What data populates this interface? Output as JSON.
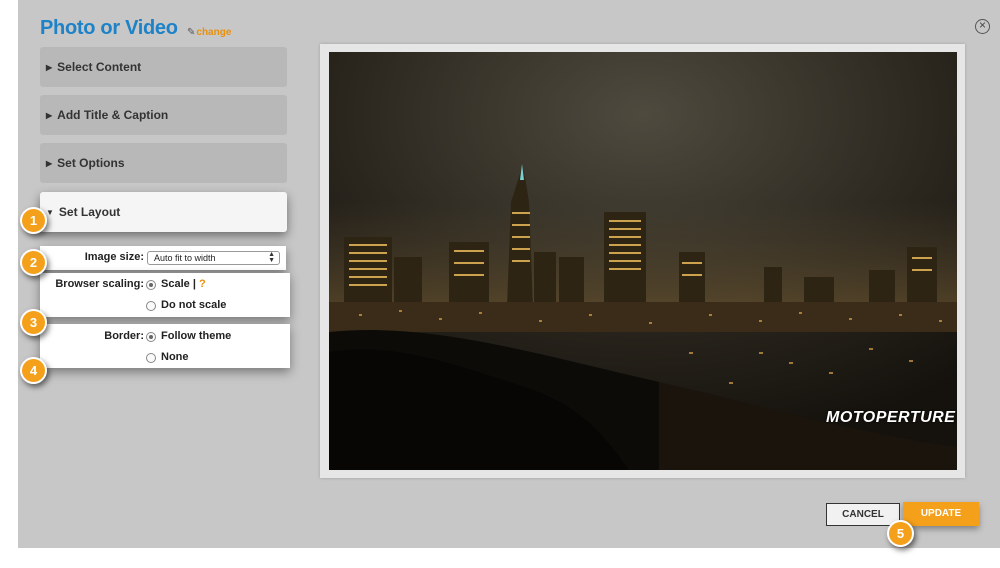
{
  "header": {
    "title": "Photo or Video",
    "change_label": "change"
  },
  "sections": [
    {
      "label": "Select Content",
      "expanded": false
    },
    {
      "label": "Add Title & Caption",
      "expanded": false
    },
    {
      "label": "Set Options",
      "expanded": false
    },
    {
      "label": "Set Layout",
      "expanded": true
    }
  ],
  "layout": {
    "image_size_label": "Image size:",
    "image_size_value": "Auto fit to width",
    "browser_scaling_label": "Browser scaling:",
    "scale_option": "Scale",
    "scale_separator": "|",
    "scale_help": "?",
    "no_scale_option": "Do not scale",
    "border_label": "Border:",
    "follow_theme_option": "Follow theme",
    "none_option": "None",
    "browser_scaling_selected": "Scale",
    "border_selected": "Follow theme"
  },
  "preview": {
    "watermark": "MOTOPERTURE"
  },
  "footer": {
    "cancel_label": "CANCEL",
    "update_label": "UPDATE"
  },
  "callouts": [
    "1",
    "2",
    "3",
    "4",
    "5"
  ],
  "colors": {
    "accent_blue": "#1e82c8",
    "accent_orange": "#f5a01a",
    "panel_bg": "#c7c7c7"
  },
  "icons": {
    "close": "close-circle-icon",
    "edit": "pencil-icon",
    "collapsed": "triangle-right-icon",
    "expanded": "triangle-down-icon"
  }
}
